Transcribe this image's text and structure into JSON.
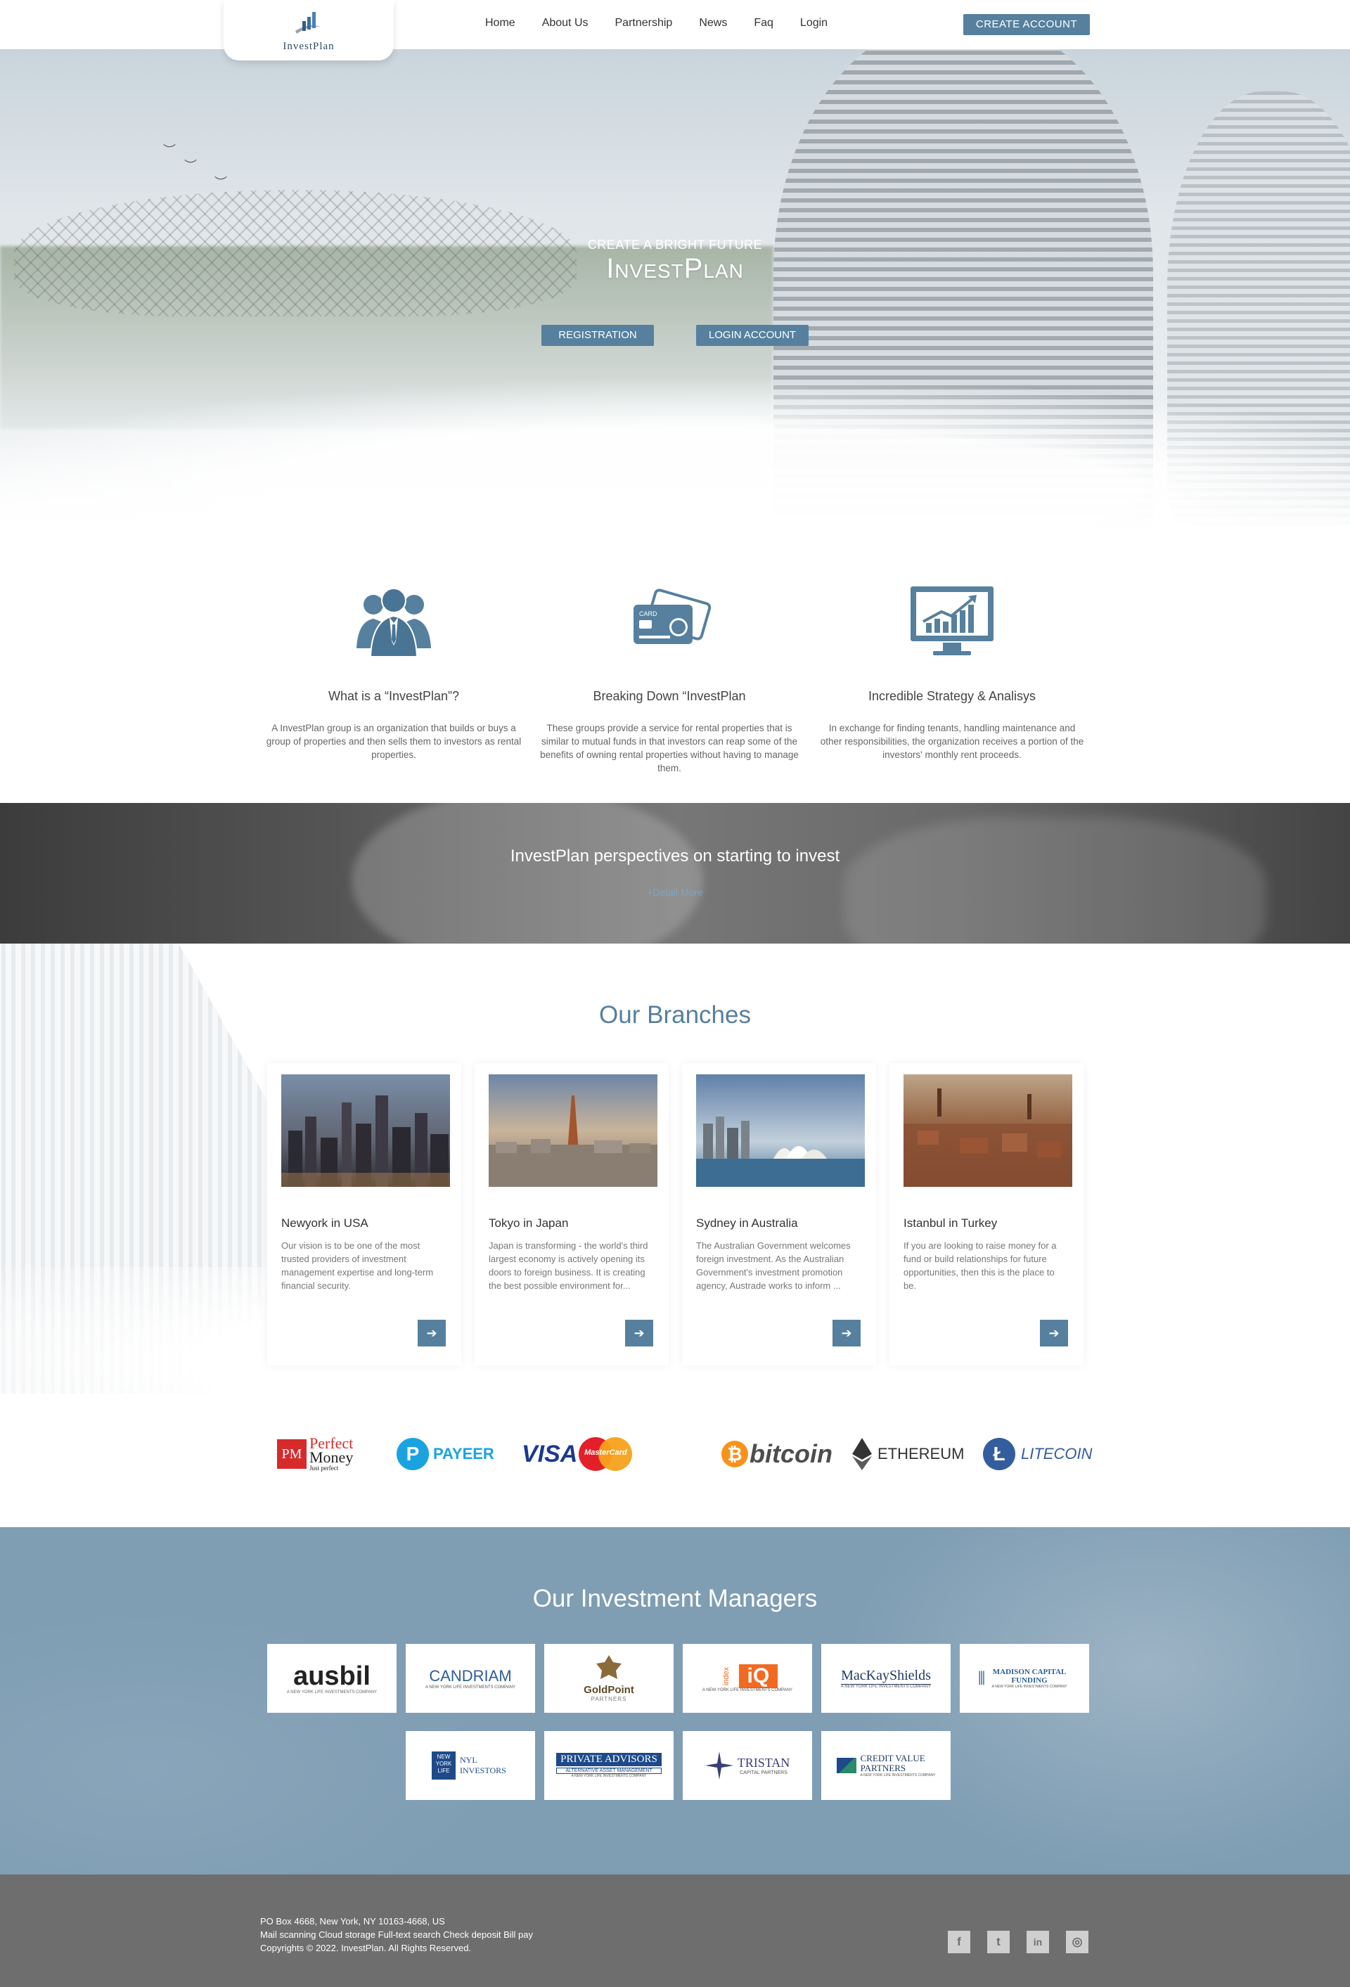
{
  "header": {
    "logo_text": "InvestPlan",
    "nav": [
      "Home",
      "About Us",
      "Partnership",
      "News",
      "Faq",
      "Login"
    ],
    "create_account": "CREATE ACCOUNT"
  },
  "hero": {
    "tagline": "CREATE A BRIGHT FUTURE",
    "title": "InvestPlan",
    "registration_button": "REGISTRATION",
    "login_button": "LOGIN ACCOUNT"
  },
  "features": [
    {
      "icon": "business-people-icon",
      "title": "What is a “InvestPlan”?",
      "text": "A InvestPlan group is an organization that builds or buys a group of properties and then sells them to investors as rental properties."
    },
    {
      "icon": "credit-card-icon",
      "title": "Breaking Down “InvestPlan",
      "text": "These groups provide a service for rental properties that is similar to mutual funds in that investors can reap some of the benefits of owning rental properties without having to manage them."
    },
    {
      "icon": "monitor-chart-icon",
      "title": "Incredible Strategy & Analisys",
      "text": "In exchange for finding tenants, handling maintenance and other responsibilities, the organization receives a portion of the investors' monthly rent proceeds."
    }
  ],
  "banner": {
    "title": "InvestPlan perspectives on starting to invest",
    "link": "+Detail More"
  },
  "branches": {
    "title": "Our Branches",
    "cards": [
      {
        "title": "Newyork in USA",
        "text": "Our vision is to be one of the most trusted providers of investment management expertise and long-term financial security."
      },
      {
        "title": "Tokyo in Japan",
        "text": "Japan is transforming - the world's third largest economy is actively opening its doors to foreign business. It is creating the best possible environment for..."
      },
      {
        "title": "Sydney in Australia",
        "text": "The Australian Government welcomes foreign investment. As the Australian Government's investment promotion agency, Austrade works to inform ..."
      },
      {
        "title": "Istanbul in Turkey",
        "text": "If you are looking to raise money for a fund or build relationships for future opportunities, then this is the place to be."
      }
    ]
  },
  "payments": {
    "perfect_money": {
      "mark": "PM",
      "line1": "Perfect",
      "line2": "Money",
      "sub": "Just perfect"
    },
    "payeer": {
      "mark": "P",
      "name": "PAYEER"
    },
    "visa": "VISA",
    "mastercard": "MasterCard",
    "bitcoin": "bitcoin",
    "ethereum": "ETHEREUM",
    "litecoin": "LITECOIN"
  },
  "managers": {
    "title": "Our Investment Managers",
    "logos": [
      {
        "name": "ausbil",
        "sub": "A NEW YORK LIFE INVESTMENTS COMPANY"
      },
      {
        "name": "CANDRIAM",
        "sub": "A NEW YORK LIFE INVESTMENTS COMPANY"
      },
      {
        "name": "GoldPoint",
        "sub": "PARTNERS"
      },
      {
        "name": "iQ",
        "prefix": "index",
        "sub": "A NEW YORK LIFE INVESTMENTS COMPANY"
      },
      {
        "name": "MacKayShields",
        "sub": "A NEW YORK LIFE INVESTMENTS COMPANY"
      },
      {
        "name": "MADISON CAPITAL FUNDING",
        "sub": "A NEW YORK LIFE INVESTMENTS COMPANY"
      },
      {
        "name": "NYL INVESTORS",
        "mark": "NEW YORK LIFE"
      },
      {
        "name": "PRIVATE ADVISORS",
        "tag": "ALTERNATIVE ASSET MANAGEMENT",
        "sub": "A NEW YORK LIFE INVESTMENTS COMPANY"
      },
      {
        "name": "TRISTAN",
        "sub": "CAPITAL PARTNERS"
      },
      {
        "name": "CREDIT VALUE PARTNERS",
        "sub": "A NEW YORK LIFE INVESTMENTS COMPANY"
      }
    ]
  },
  "footer": {
    "address": "PO Box 4668, New York, NY 10163-4668, US",
    "services": "Mail scanning Cloud storage Full-text search Check deposit Bill pay",
    "copyright": "Copyrights © 2022. InvestPlan. All Rights Reserved.",
    "social": [
      {
        "icon": "facebook-icon",
        "glyph": "f"
      },
      {
        "icon": "twitter-icon",
        "glyph": "t"
      },
      {
        "icon": "linkedin-icon",
        "glyph": "in"
      },
      {
        "icon": "dribbble-icon",
        "glyph": "◎"
      }
    ]
  },
  "colors": {
    "accent": "#56809e",
    "managers_bg": "#7f9db3",
    "footer_bg": "#6e6e6e"
  }
}
